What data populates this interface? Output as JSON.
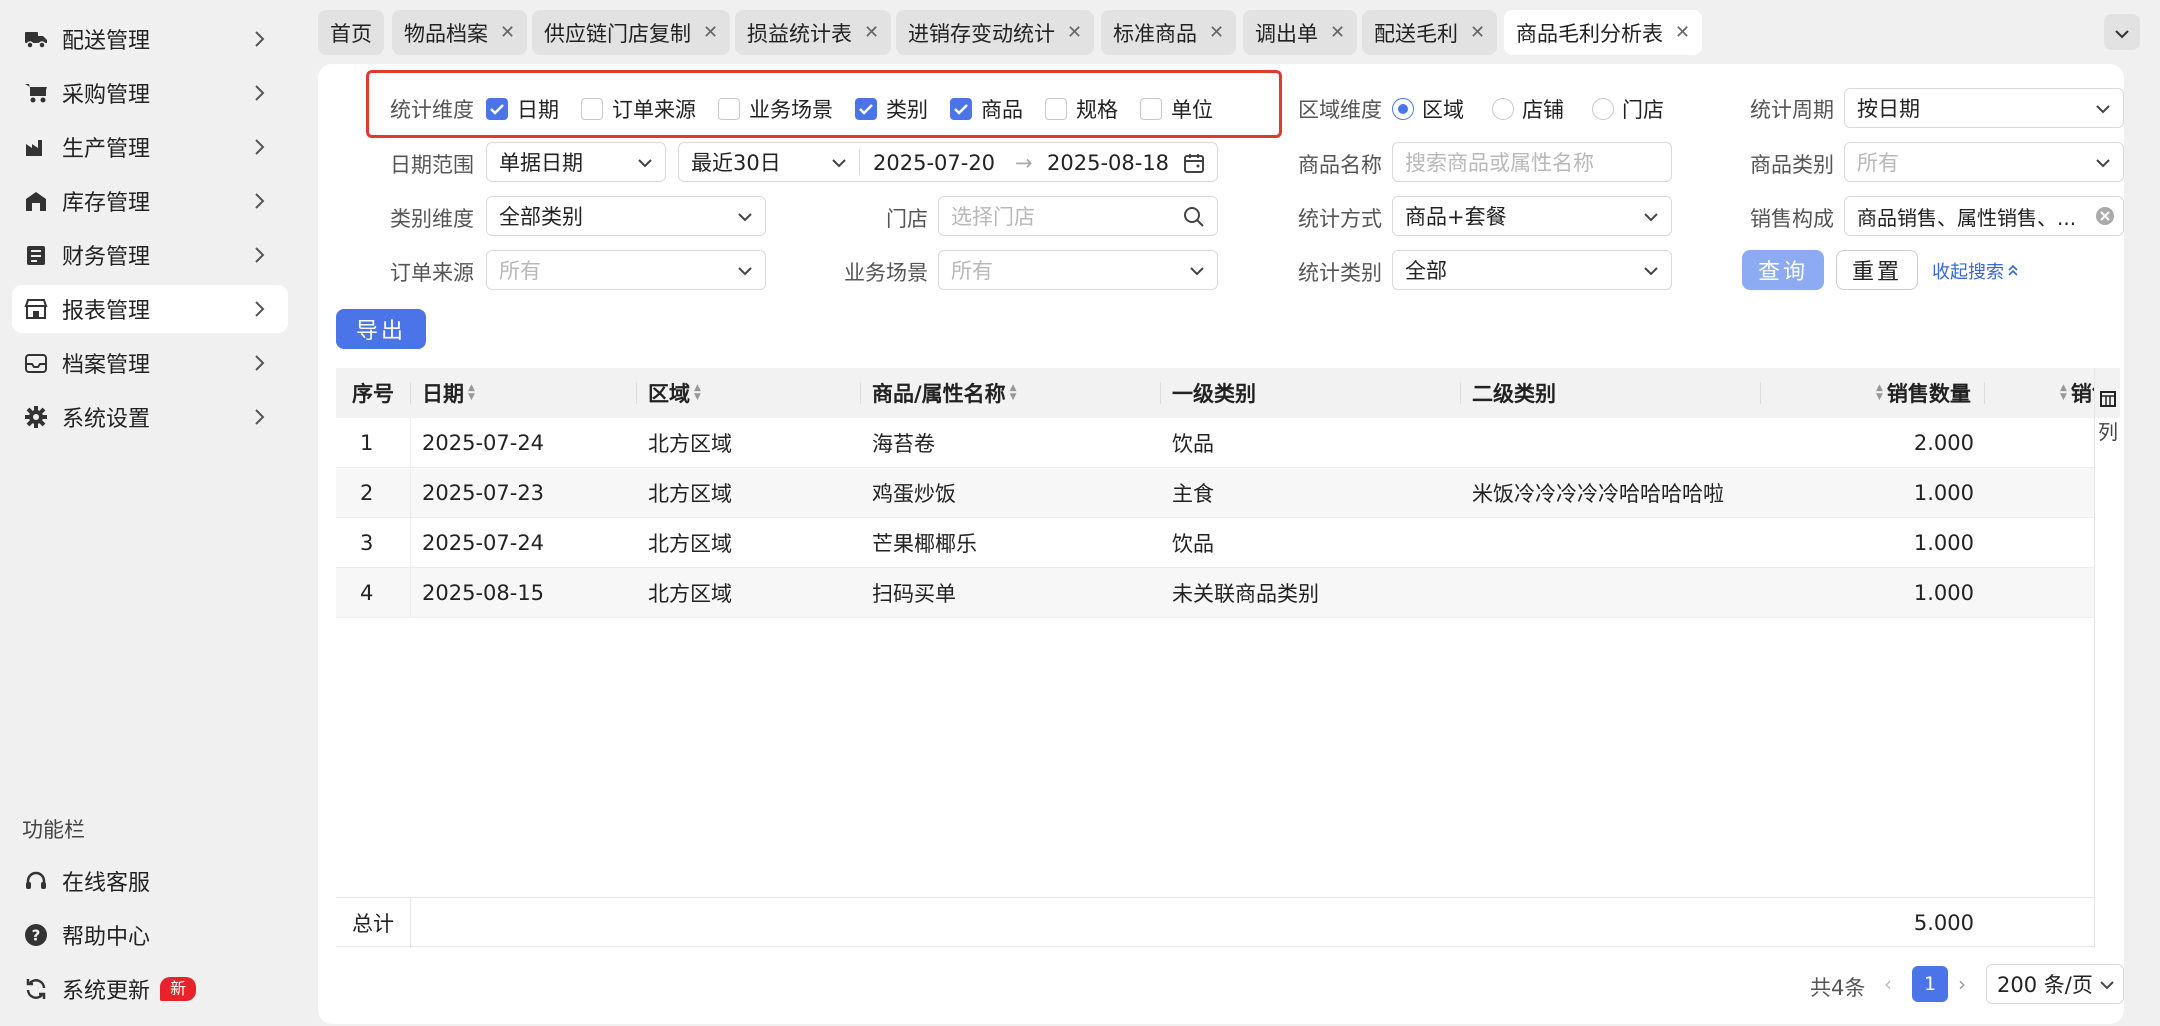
{
  "sidebar": {
    "items": [
      {
        "label": "配送管理",
        "icon": "truck-icon"
      },
      {
        "label": "采购管理",
        "icon": "cart-icon"
      },
      {
        "label": "生产管理",
        "icon": "factory-icon"
      },
      {
        "label": "库存管理",
        "icon": "warehouse-icon"
      },
      {
        "label": "财务管理",
        "icon": "ledger-icon"
      },
      {
        "label": "报表管理",
        "icon": "store-icon"
      },
      {
        "label": "档案管理",
        "icon": "archive-icon"
      },
      {
        "label": "系统设置",
        "icon": "gear-icon"
      }
    ],
    "active_index": 5,
    "func_title": "功能栏",
    "func_items": [
      {
        "label": "在线客服",
        "icon": "headset-icon"
      },
      {
        "label": "帮助中心",
        "icon": "help-icon"
      },
      {
        "label": "系统更新",
        "icon": "refresh-icon"
      }
    ],
    "new_badge": "新"
  },
  "tabs": [
    {
      "label": "首页",
      "closable": false
    },
    {
      "label": "物品档案",
      "closable": true
    },
    {
      "label": "供应链门店复制",
      "closable": true
    },
    {
      "label": "损益统计表",
      "closable": true
    },
    {
      "label": "进销存变动统计",
      "closable": true
    },
    {
      "label": "标准商品",
      "closable": true
    },
    {
      "label": "调出单",
      "closable": true
    },
    {
      "label": "配送毛利",
      "closable": true
    },
    {
      "label": "商品毛利分析表",
      "closable": true,
      "active": true
    }
  ],
  "filters": {
    "stat_dim_label": "统计维度",
    "stat_dims": [
      {
        "label": "日期",
        "checked": true
      },
      {
        "label": "订单来源",
        "checked": false
      },
      {
        "label": "业务场景",
        "checked": false
      },
      {
        "label": "类别",
        "checked": true
      },
      {
        "label": "商品",
        "checked": true
      },
      {
        "label": "规格",
        "checked": false
      },
      {
        "label": "单位",
        "checked": false
      }
    ],
    "region_dim_label": "区域维度",
    "region_dims": [
      {
        "label": "区域",
        "checked": true
      },
      {
        "label": "店铺",
        "checked": false
      },
      {
        "label": "门店",
        "checked": false
      }
    ],
    "period_label": "统计周期",
    "period_value": "按日期",
    "date_range_label": "日期范围",
    "date_type": "单据日期",
    "date_preset": "最近30日",
    "date_from": "2025-07-20",
    "date_to": "2025-08-18",
    "date_arrow": "→",
    "product_name_label": "商品名称",
    "product_name_placeholder": "搜索商品或属性名称",
    "product_category_label": "商品类别",
    "product_category_placeholder": "所有",
    "category_dim_label": "类别维度",
    "category_dim_value": "全部类别",
    "store_label": "门店",
    "store_placeholder": "选择门店",
    "stat_method_label": "统计方式",
    "stat_method_value": "商品+套餐",
    "sales_comp_label": "销售构成",
    "sales_comp_value": "商品销售、属性销售、...",
    "order_source_label": "订单来源",
    "order_source_placeholder": "所有",
    "biz_scene_label": "业务场景",
    "biz_scene_placeholder": "所有",
    "stat_type_label": "统计类别",
    "stat_type_value": "全部",
    "query_label": "查询",
    "reset_label": "重置",
    "collapse_label": "收起搜索"
  },
  "export_label": "导出",
  "table": {
    "columns": [
      "序号",
      "日期",
      "区域",
      "商品/属性名称",
      "一级类别",
      "二级类别",
      "销售数量",
      "销售"
    ],
    "rows": [
      [
        "1",
        "2025-07-24",
        "北方区域",
        "海苔卷",
        "饮品",
        "",
        "2.000"
      ],
      [
        "2",
        "2025-07-23",
        "北方区域",
        "鸡蛋炒饭",
        "主食",
        "米饭冷冷冷冷冷哈哈哈哈啦",
        "1.000"
      ],
      [
        "3",
        "2025-07-24",
        "北方区域",
        "芒果椰椰乐",
        "饮品",
        "",
        "1.000"
      ],
      [
        "4",
        "2025-08-15",
        "北方区域",
        "扫码买单",
        "未关联商品类别",
        "",
        "1.000"
      ]
    ],
    "column_setting": "列",
    "total_label": "总计",
    "total_qty": "5.000"
  },
  "pagination": {
    "total_text": "共4条",
    "current_page": "1",
    "page_size": "200 条/页"
  },
  "colors": {
    "accent": "#4a74e8",
    "highlight_border": "#e03a2f",
    "badge": "#e8222b"
  }
}
